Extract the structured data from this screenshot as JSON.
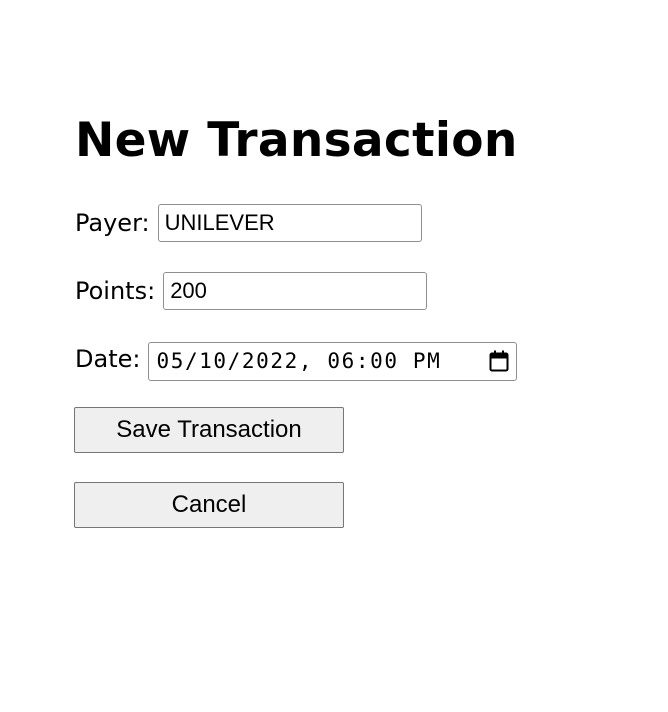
{
  "page": {
    "title": "New Transaction"
  },
  "form": {
    "payer": {
      "label": "Payer:",
      "value": "UNILEVER"
    },
    "points": {
      "label": "Points:",
      "value": "200"
    },
    "date": {
      "label": "Date:",
      "value": "05/10/2022, 06:00 PM",
      "icon": "calendar-icon"
    }
  },
  "actions": {
    "save_label": "Save Transaction",
    "cancel_label": "Cancel"
  },
  "colors": {
    "background": "#ffffff",
    "button_bg": "#efefef",
    "border": "#8f8f8f"
  }
}
